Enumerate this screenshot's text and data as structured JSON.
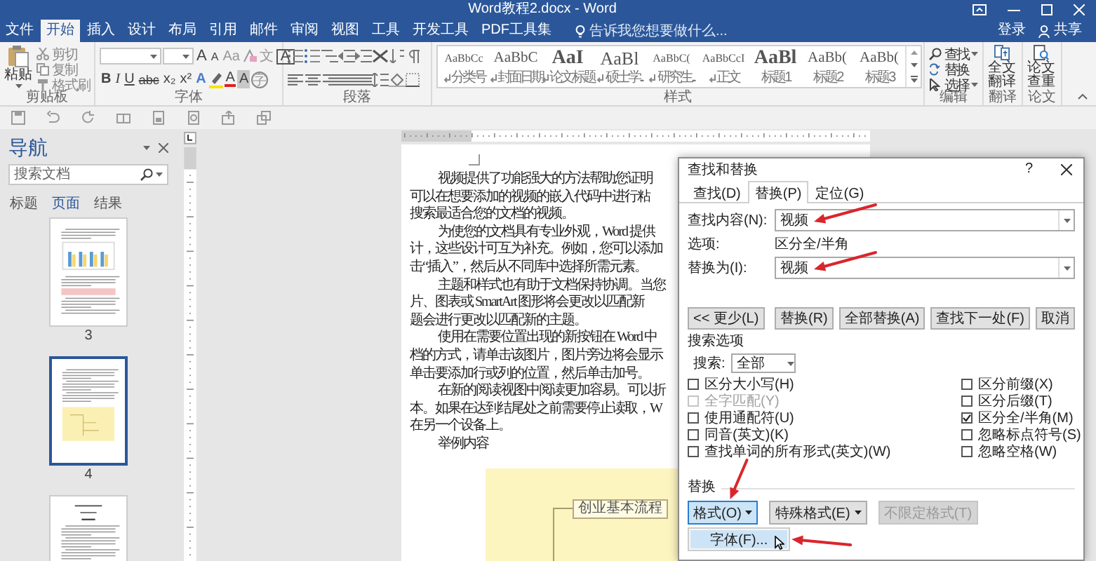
{
  "window": {
    "title": "Word教程2.docx - Word"
  },
  "tabs": [
    {
      "label": "文件",
      "selected": false
    },
    {
      "label": "开始",
      "selected": true
    },
    {
      "label": "插入",
      "selected": false
    },
    {
      "label": "设计",
      "selected": false
    },
    {
      "label": "布局",
      "selected": false
    },
    {
      "label": "引用",
      "selected": false
    },
    {
      "label": "邮件",
      "selected": false
    },
    {
      "label": "审阅",
      "selected": false
    },
    {
      "label": "视图",
      "selected": false
    },
    {
      "label": "工具",
      "selected": false
    },
    {
      "label": "开发工具",
      "selected": false
    },
    {
      "label": "PDF工具集",
      "selected": false
    }
  ],
  "tell_me": {
    "placeholder": "告诉我您想要做什么..."
  },
  "account": {
    "sign_in": "登录",
    "share": "共享"
  },
  "ribbon": {
    "clipboard": {
      "label": "剪贴板",
      "paste": "粘贴",
      "commands": [
        "剪切",
        "复制",
        "格式刷"
      ]
    },
    "font": {
      "label": "字体",
      "row1": [
        {
          "glyph": "A",
          "kind": "grow"
        },
        {
          "glyph": "A",
          "kind": "shrink"
        },
        {
          "glyph": "Aa",
          "kind": "case"
        },
        {
          "glyph": "文",
          "kind": "pinyin"
        },
        {
          "glyph": "A",
          "kind": "border"
        }
      ],
      "row2": [
        {
          "glyph": "B",
          "kind": "bold"
        },
        {
          "glyph": "I",
          "kind": "italic"
        },
        {
          "glyph": "U",
          "kind": "underline"
        },
        {
          "glyph": "abc",
          "kind": "strike"
        },
        {
          "glyph": "x₂",
          "kind": "sub"
        },
        {
          "glyph": "x²",
          "kind": "sup"
        },
        {
          "glyph": "A",
          "kind": "effects"
        },
        {
          "glyph": "A",
          "kind": "color"
        },
        {
          "glyph": "A",
          "kind": "shading"
        },
        {
          "glyph": "字",
          "kind": "enclose"
        }
      ]
    },
    "paragraph": {
      "label": "段落"
    },
    "styles": {
      "label": "样式",
      "items": [
        {
          "sample": "AaBbCc",
          "name": "分类号",
          "mark": true,
          "kind": "small"
        },
        {
          "sample": "AaBbC",
          "name": "封面日期",
          "mark": true,
          "kind": "medium"
        },
        {
          "sample": "AaI",
          "name": "论文标题",
          "mark": true,
          "kind": "title"
        },
        {
          "sample": "AaBl",
          "name": "硕士学...",
          "mark": true,
          "kind": "large"
        },
        {
          "sample": "AaBbC(",
          "name": "研究生...",
          "mark": true,
          "kind": "small"
        },
        {
          "sample": "AaBbCcI",
          "name": "正文",
          "mark": true,
          "kind": "small"
        },
        {
          "sample": "AaBl",
          "name": "标题 1",
          "mark": false,
          "kind": "title"
        },
        {
          "sample": "AaBb(",
          "name": "标题 2",
          "mark": false,
          "kind": "medium"
        },
        {
          "sample": "AaBb(",
          "name": "标题 3",
          "mark": false,
          "kind": "medium"
        }
      ]
    },
    "editing": {
      "label": "编辑",
      "commands": [
        {
          "label": "查找",
          "dropdown": true
        },
        {
          "label": "替换",
          "dropdown": false
        },
        {
          "label": "选择",
          "dropdown": true
        }
      ]
    },
    "translate": {
      "label": "翻译",
      "button": "全文翻译"
    },
    "thesis": {
      "label": "论文",
      "button": "论文查重"
    }
  },
  "navigation": {
    "title": "导航",
    "search": {
      "placeholder": "搜索文档"
    },
    "tabs": [
      {
        "label": "标题",
        "selected": false
      },
      {
        "label": "页面",
        "selected": true
      },
      {
        "label": "结果",
        "selected": false
      }
    ],
    "pages": [
      {
        "number": "3",
        "kind": "chart",
        "selected": false
      },
      {
        "number": "4",
        "kind": "diagram",
        "selected": true
      },
      {
        "kind": "table",
        "selected": false
      }
    ]
  },
  "document": {
    "paragraphs": [
      [
        "视频提供了功能强大的方法帮助您证明",
        "可以在想要添加的视频的嵌入代码中进行粘",
        "搜索最适合您的文档的视频。"
      ],
      [
        "为使您的文档具有专业外观，Word 提供",
        "计，这些设计可互为补充。例如，您可以添加",
        "击“插入”，然后从不同库中选择所需元素。"
      ],
      [
        "主题和样式也有助于文档保持协调。当您",
        "片、图表或 SmartArt 图形将会更改以匹配新",
        "题会进行更改以匹配新的主题。"
      ],
      [
        "使用在需要位置出现的新按钮在 Word 中",
        "档的方式，请单击该图片，图片旁边将会显示",
        "单击要添加行或列的位置，然后单击加号。"
      ],
      [
        "在新的阅读视图中阅读更加容易。可以折",
        "本。如果在达到结尾处之前需要停止读取，W",
        "在另一个设备上。"
      ],
      [
        "举例内容"
      ]
    ],
    "figure": {
      "node": "创业基本流程"
    }
  },
  "dialog": {
    "title": "查找和替换",
    "help": "?",
    "tabs": [
      {
        "label": "查找(D)",
        "selected": false
      },
      {
        "label": "替换(P)",
        "selected": true
      },
      {
        "label": "定位(G)",
        "selected": false
      }
    ],
    "find": {
      "label": "查找内容(N):",
      "value": "视频",
      "arrow": true
    },
    "options": {
      "label": "选项:",
      "value": "区分全/半角"
    },
    "replace": {
      "label": "替换为(I):",
      "value": "视频",
      "arrow": true
    },
    "buttons": [
      "<< 更少(L)",
      "替换(R)",
      "全部替换(A)",
      "查找下一处(F)",
      "取消"
    ],
    "search_options": {
      "title": "搜索选项",
      "label": "搜索:",
      "value": "全部"
    },
    "checkboxes_left": [
      {
        "label": "区分大小写(H)",
        "checked": false,
        "disabled": false
      },
      {
        "label": "全字匹配(Y)",
        "checked": false,
        "disabled": true
      },
      {
        "label": "使用通配符(U)",
        "checked": false,
        "disabled": false
      },
      {
        "label": "同音(英文)(K)",
        "checked": false,
        "disabled": false
      },
      {
        "label": "查找单词的所有形式(英文)(W)",
        "checked": false,
        "disabled": false
      }
    ],
    "checkboxes_right": [
      {
        "label": "区分前缀(X)",
        "checked": false,
        "disabled": false
      },
      {
        "label": "区分后缀(T)",
        "checked": false,
        "disabled": false
      },
      {
        "label": "区分全/半角(M)",
        "checked": true,
        "disabled": false
      },
      {
        "label": "忽略标点符号(S)",
        "checked": false,
        "disabled": false
      },
      {
        "label": "忽略空格(W)",
        "checked": false,
        "disabled": false
      }
    ],
    "replace_section": {
      "title": "替换",
      "buttons": [
        {
          "label": "格式(O)",
          "dropdown": true,
          "pressed": true,
          "disabled": false,
          "arrow": true
        },
        {
          "label": "特殊格式(E)",
          "dropdown": true,
          "pressed": false,
          "disabled": false,
          "arrow": false
        },
        {
          "label": "不限定格式(T)",
          "dropdown": false,
          "pressed": false,
          "disabled": true,
          "arrow": false
        }
      ]
    },
    "menu": {
      "items": [
        {
          "label": "字体(F)...",
          "selected": true,
          "arrow": true
        }
      ]
    }
  }
}
